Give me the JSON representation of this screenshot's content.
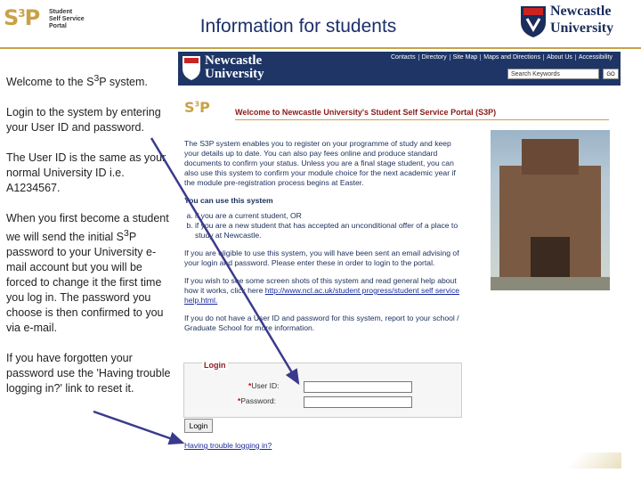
{
  "header": {
    "brand_mark": "S",
    "brand_sup": "3",
    "brand_tail": "P",
    "brand_sub": [
      "Student",
      "Self Service",
      "Portal"
    ],
    "title": "Information for students",
    "university_name": [
      "Newcastle",
      "University"
    ]
  },
  "instructions": {
    "p1_pre": "Welcome to the S",
    "p1_sup": "3",
    "p1_post": "P system.",
    "p2": "Login to the system by entering your User ID and password.",
    "p3": "The User ID is the same as your normal University ID i.e. A1234567.",
    "p4_pre": "When you first become a student we will send the initial S",
    "p4_sup": "3",
    "p4_post": "P password to your University e-mail account but you will be forced to change it the first time you log in. The password you choose is then confirmed to you via e-mail.",
    "p5": "If you have forgotten your password use the 'Having trouble logging in?' link to reset it."
  },
  "portal": {
    "nav_brand": [
      "Newcastle",
      "University"
    ],
    "nav_links": [
      "Contacts",
      "Directory",
      "Site Map",
      "Maps and Directions",
      "About Us",
      "Accessibility"
    ],
    "search_placeholder": "Search Keywords",
    "go_label": "GO",
    "inner_mark": "S",
    "inner_sup": "3",
    "inner_tail": "P",
    "welcome": "Welcome to Newcastle University's Student Self Service Portal (S3P)",
    "intro": "The S3P system enables you to register on your programme of study and keep your details up to date. You can also pay fees online and produce standard documents to confirm your status. Unless you are a final stage student, you can also use this system to confirm your module choice for the next academic year if the module pre-registration process begins at Easter.",
    "use_label": "You can use this system",
    "use_items": [
      "if you are a current student, OR",
      "if you are a new student that has accepted an unconditional offer of a place to study at Newcastle."
    ],
    "eligible": "If you are eligible to use this system, you will have been sent an email advising of your login and password. Please enter these in order to login to the portal.",
    "screenshots_pre": "If you wish to see some screen shots of this system and read general help about how it works, click here ",
    "screenshots_link": "http://www.ncl.ac.uk/student progress/student self service help.html.",
    "no_id": "If you do not have a User ID and password for this system, report to your school / Graduate School for more information.",
    "login_title": "Login",
    "userid_label": "User ID:",
    "password_label": "Password:",
    "required_mark": "*",
    "login_button": "Login",
    "trouble_link": "Having trouble logging in?"
  },
  "colors": {
    "brand_gold": "#c8a248",
    "navy": "#1e3566",
    "title_blue": "#1b2f6b",
    "arrow": "#3a3a8c"
  }
}
